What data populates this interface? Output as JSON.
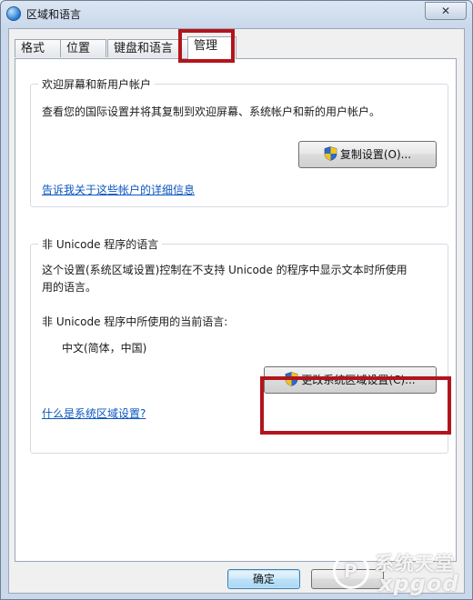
{
  "window": {
    "title": "区域和语言",
    "close": "✕"
  },
  "tabs": [
    {
      "label": "格式"
    },
    {
      "label": "位置"
    },
    {
      "label": "键盘和语言"
    },
    {
      "label": "管理"
    }
  ],
  "welcome_group": {
    "title": "欢迎屏幕和新用户帐户",
    "description": "查看您的国际设置并将其复制到欢迎屏幕、系统帐户和新的用户帐户。",
    "copy_button": "复制设置(O)...",
    "details_link": "告诉我关于这些帐户的详细信息"
  },
  "unicode_group": {
    "title": "非 Unicode 程序的语言",
    "description_line1": "这个设置(系统区域设置)控制在不支持 Unicode 的程序中显示文本时所使用",
    "description_line2": "用的语言。",
    "current_label": "非 Unicode 程序中所使用的当前语言:",
    "current_value": "中文(简体，中国)",
    "change_button": "更改系统区域设置(C)...",
    "what_link": "什么是系统区域设置?"
  },
  "footer": {
    "ok": "确定",
    "cancel": ""
  },
  "watermark": {
    "top": "系统天堂",
    "bottom": "xpgod",
    "mark": "P"
  }
}
